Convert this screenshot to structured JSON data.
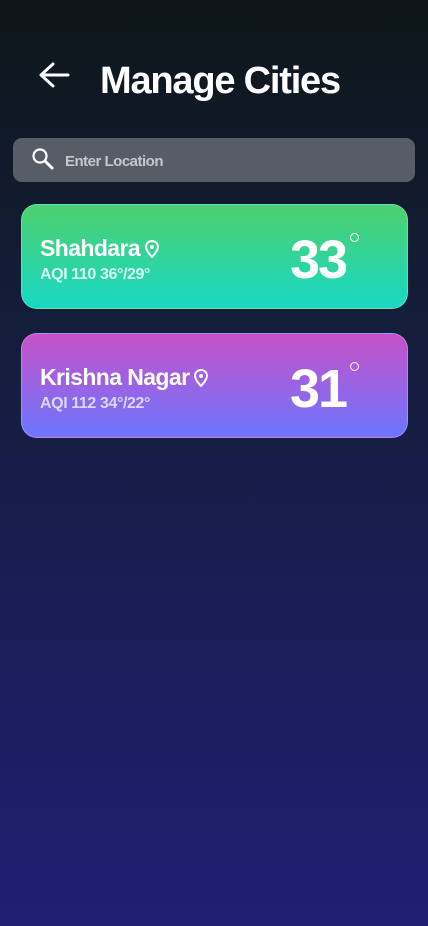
{
  "header": {
    "title": "Manage Cities",
    "back_icon": "arrow-left-icon"
  },
  "search": {
    "placeholder": "Enter Location",
    "icon": "search-icon"
  },
  "cities": [
    {
      "name": "Shahdara",
      "aqi_label": "AQI",
      "aqi": "110",
      "high_low": "36°/29°",
      "temperature": "33",
      "gradient": [
        "#4ed06e",
        "#18d8c4"
      ]
    },
    {
      "name": "Krishna Nagar",
      "aqi_label": "AQI",
      "aqi": "112",
      "high_low": "34°/22°",
      "temperature": "31",
      "gradient": [
        "#c651c8",
        "#6c76ff"
      ]
    }
  ],
  "colors": {
    "background_top": "#0e1619",
    "background_bottom": "#201f74",
    "search_bg": "#575d66"
  }
}
